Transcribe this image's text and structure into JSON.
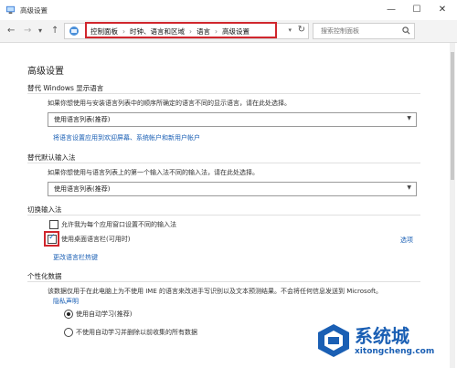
{
  "window": {
    "title": "高级设置",
    "minimize": "—",
    "maximize": "☐",
    "close": "✕"
  },
  "addressbar": {
    "back": "←",
    "forward": "→",
    "up_dropdown": "▾",
    "up": "↑",
    "breadcrumb": [
      "控制面板",
      "时钟、语言和区域",
      "语言",
      "高级设置"
    ],
    "breadcrumb_sep": "›",
    "dropdown": "▾",
    "refresh": "↻",
    "search_placeholder": "搜索控制面板"
  },
  "page": {
    "title": "高级设置",
    "display_language": {
      "heading": "替代 Windows 显示语言",
      "description": "如果你想使用与安装语言列表中的顺序所确定的语言不同的显示语言，请在此处选择。",
      "select_value": "使用语言列表(推荐)",
      "link": "将语言设置应用到欢迎屏幕、系统帐户和新用户帐户"
    },
    "default_input": {
      "heading": "替代默认输入法",
      "description": "如果你想使用与语言列表上的第一个输入法不同的输入法，请在此处选择。",
      "select_value": "使用语言列表(推荐)"
    },
    "switch_input": {
      "heading": "切换输入法",
      "option_per_app": "允许我为每个应用窗口设置不同的输入法",
      "option_per_app_checked": false,
      "option_language_bar": "使用桌面语言栏(可用时)",
      "option_language_bar_checked": true,
      "options_link": "选项",
      "hotkeys_link": "更改语言栏热键"
    },
    "personalization": {
      "heading": "个性化数据",
      "description": "该数据仅用于在此电脑上为不使用 IME 的语言来改进手写识别以及文本预测结果。不会将任何信息发送到 Microsoft。",
      "privacy_link": "隐私声明",
      "radio_auto": "使用自动学习(推荐)",
      "radio_auto_selected": true,
      "radio_manual": "不使用自动学习并删除以前收集的所有数据",
      "radio_manual_selected": false
    }
  },
  "watermark": {
    "text": "系统城",
    "url": "xitongcheng.com"
  },
  "colors": {
    "highlight": "#d0262d",
    "link": "#1a5fb4"
  }
}
